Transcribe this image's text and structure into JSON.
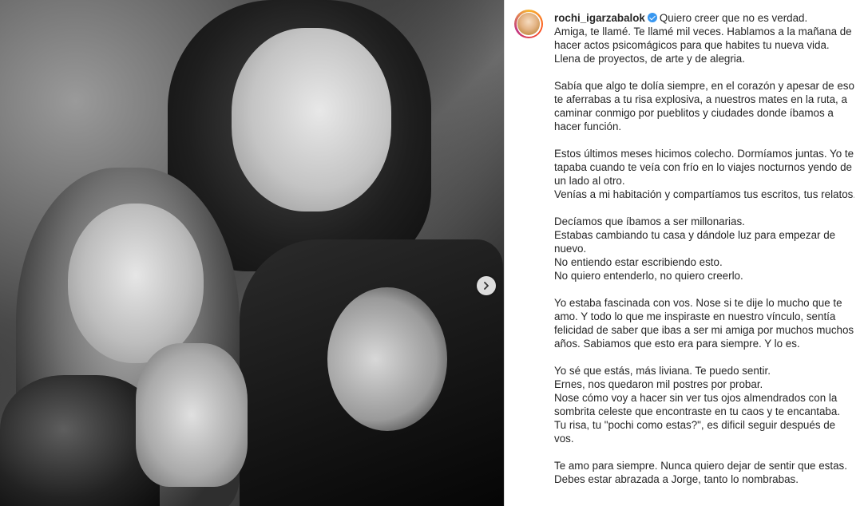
{
  "post": {
    "username": "rochi_igarzabalok",
    "first_line": "Quiero creer que no es verdad.",
    "paragraphs": [
      "Amiga, te llamé. Te llamé mil veces. Hablamos a la mañana de hacer actos psicomágicos para que habites tu nueva vida. Llena de proyectos, de arte y de alegria.",
      "Sabía que algo te dolía siempre, en el corazón y apesar de eso te aferrabas a tu risa explosiva, a nuestros mates en la ruta, a caminar conmigo por pueblitos y ciudades donde íbamos a hacer función.",
      "Estos últimos meses hicimos colecho. Dormíamos juntas. Yo te tapaba cuando te veía con frío en lo viajes nocturnos yendo de un lado al otro.\nVenías a mi habitación y compartíamos tus escritos, tus relatos.",
      "Decíamos que íbamos a ser millonarias.\nEstabas cambiando tu casa y dándole luz para empezar de nuevo.\nNo entiendo estar escribiendo esto.\nNo quiero entenderlo, no quiero creerlo.",
      "Yo estaba fascinada con vos. Nose si te dije lo mucho que te amo. Y todo lo que me inspiraste en nuestro vínculo, sentía felicidad de saber que ibas a ser mi amiga por muchos muchos años. Sabiamos que esto era para siempre. Y lo es.",
      "Yo sé que estás, más liviana. Te puedo sentir.\nErnes, nos quedaron mil postres por probar.\nNose cómo voy a hacer sin ver tus ojos almendrados con la sombrita celeste que encontraste en tu caos y te encantaba.\nTu risa, tu \"pochi como estas?\", es dificil seguir después de vos.",
      "Te amo para siempre. Nunca quiero dejar de sentir que estas.\nDebes estar abrazada a Jorge, tanto lo nombrabas."
    ]
  },
  "icons": {
    "verified": "verified-badge-icon",
    "next": "chevron-right-icon"
  },
  "colors": {
    "verified": "#3897f0",
    "text": "#262626"
  }
}
